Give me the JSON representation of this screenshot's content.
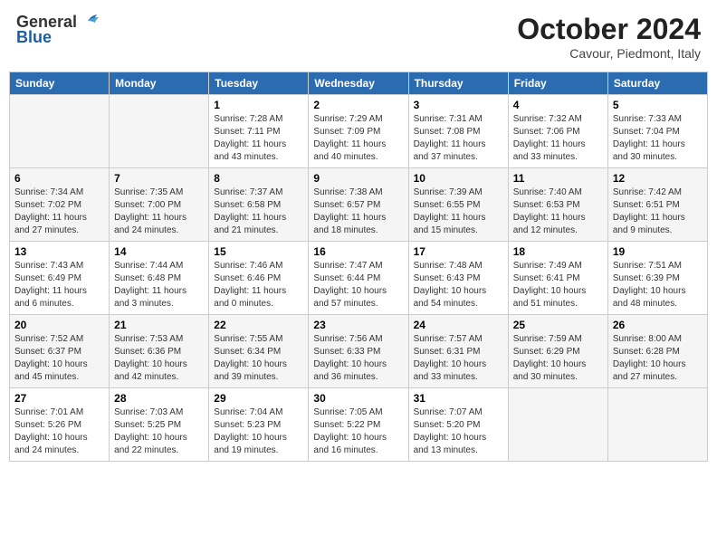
{
  "header": {
    "logo_general": "General",
    "logo_blue": "Blue",
    "title": "October 2024",
    "location": "Cavour, Piedmont, Italy"
  },
  "weekdays": [
    "Sunday",
    "Monday",
    "Tuesday",
    "Wednesday",
    "Thursday",
    "Friday",
    "Saturday"
  ],
  "weeks": [
    [
      {
        "day": "",
        "info": ""
      },
      {
        "day": "",
        "info": ""
      },
      {
        "day": "1",
        "info": "Sunrise: 7:28 AM\nSunset: 7:11 PM\nDaylight: 11 hours and 43 minutes."
      },
      {
        "day": "2",
        "info": "Sunrise: 7:29 AM\nSunset: 7:09 PM\nDaylight: 11 hours and 40 minutes."
      },
      {
        "day": "3",
        "info": "Sunrise: 7:31 AM\nSunset: 7:08 PM\nDaylight: 11 hours and 37 minutes."
      },
      {
        "day": "4",
        "info": "Sunrise: 7:32 AM\nSunset: 7:06 PM\nDaylight: 11 hours and 33 minutes."
      },
      {
        "day": "5",
        "info": "Sunrise: 7:33 AM\nSunset: 7:04 PM\nDaylight: 11 hours and 30 minutes."
      }
    ],
    [
      {
        "day": "6",
        "info": "Sunrise: 7:34 AM\nSunset: 7:02 PM\nDaylight: 11 hours and 27 minutes."
      },
      {
        "day": "7",
        "info": "Sunrise: 7:35 AM\nSunset: 7:00 PM\nDaylight: 11 hours and 24 minutes."
      },
      {
        "day": "8",
        "info": "Sunrise: 7:37 AM\nSunset: 6:58 PM\nDaylight: 11 hours and 21 minutes."
      },
      {
        "day": "9",
        "info": "Sunrise: 7:38 AM\nSunset: 6:57 PM\nDaylight: 11 hours and 18 minutes."
      },
      {
        "day": "10",
        "info": "Sunrise: 7:39 AM\nSunset: 6:55 PM\nDaylight: 11 hours and 15 minutes."
      },
      {
        "day": "11",
        "info": "Sunrise: 7:40 AM\nSunset: 6:53 PM\nDaylight: 11 hours and 12 minutes."
      },
      {
        "day": "12",
        "info": "Sunrise: 7:42 AM\nSunset: 6:51 PM\nDaylight: 11 hours and 9 minutes."
      }
    ],
    [
      {
        "day": "13",
        "info": "Sunrise: 7:43 AM\nSunset: 6:49 PM\nDaylight: 11 hours and 6 minutes."
      },
      {
        "day": "14",
        "info": "Sunrise: 7:44 AM\nSunset: 6:48 PM\nDaylight: 11 hours and 3 minutes."
      },
      {
        "day": "15",
        "info": "Sunrise: 7:46 AM\nSunset: 6:46 PM\nDaylight: 11 hours and 0 minutes."
      },
      {
        "day": "16",
        "info": "Sunrise: 7:47 AM\nSunset: 6:44 PM\nDaylight: 10 hours and 57 minutes."
      },
      {
        "day": "17",
        "info": "Sunrise: 7:48 AM\nSunset: 6:43 PM\nDaylight: 10 hours and 54 minutes."
      },
      {
        "day": "18",
        "info": "Sunrise: 7:49 AM\nSunset: 6:41 PM\nDaylight: 10 hours and 51 minutes."
      },
      {
        "day": "19",
        "info": "Sunrise: 7:51 AM\nSunset: 6:39 PM\nDaylight: 10 hours and 48 minutes."
      }
    ],
    [
      {
        "day": "20",
        "info": "Sunrise: 7:52 AM\nSunset: 6:37 PM\nDaylight: 10 hours and 45 minutes."
      },
      {
        "day": "21",
        "info": "Sunrise: 7:53 AM\nSunset: 6:36 PM\nDaylight: 10 hours and 42 minutes."
      },
      {
        "day": "22",
        "info": "Sunrise: 7:55 AM\nSunset: 6:34 PM\nDaylight: 10 hours and 39 minutes."
      },
      {
        "day": "23",
        "info": "Sunrise: 7:56 AM\nSunset: 6:33 PM\nDaylight: 10 hours and 36 minutes."
      },
      {
        "day": "24",
        "info": "Sunrise: 7:57 AM\nSunset: 6:31 PM\nDaylight: 10 hours and 33 minutes."
      },
      {
        "day": "25",
        "info": "Sunrise: 7:59 AM\nSunset: 6:29 PM\nDaylight: 10 hours and 30 minutes."
      },
      {
        "day": "26",
        "info": "Sunrise: 8:00 AM\nSunset: 6:28 PM\nDaylight: 10 hours and 27 minutes."
      }
    ],
    [
      {
        "day": "27",
        "info": "Sunrise: 7:01 AM\nSunset: 5:26 PM\nDaylight: 10 hours and 24 minutes."
      },
      {
        "day": "28",
        "info": "Sunrise: 7:03 AM\nSunset: 5:25 PM\nDaylight: 10 hours and 22 minutes."
      },
      {
        "day": "29",
        "info": "Sunrise: 7:04 AM\nSunset: 5:23 PM\nDaylight: 10 hours and 19 minutes."
      },
      {
        "day": "30",
        "info": "Sunrise: 7:05 AM\nSunset: 5:22 PM\nDaylight: 10 hours and 16 minutes."
      },
      {
        "day": "31",
        "info": "Sunrise: 7:07 AM\nSunset: 5:20 PM\nDaylight: 10 hours and 13 minutes."
      },
      {
        "day": "",
        "info": ""
      },
      {
        "day": "",
        "info": ""
      }
    ]
  ]
}
